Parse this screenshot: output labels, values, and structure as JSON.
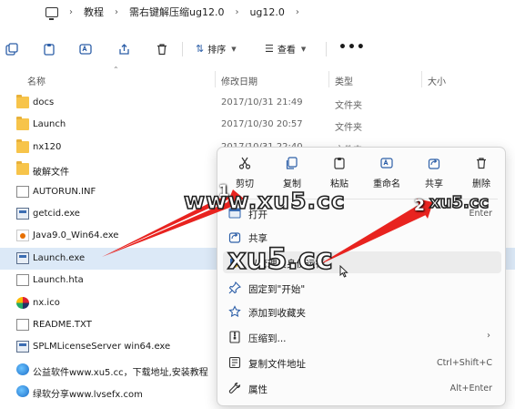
{
  "breadcrumb": [
    "教程",
    "需右键解压缩ug12.0",
    "ug12.0"
  ],
  "toolbar": {
    "sort_label": "排序",
    "view_label": "查看",
    "more_label": "•••"
  },
  "columns": {
    "name": "名称",
    "date": "修改日期",
    "type": "类型",
    "size": "大小"
  },
  "files": [
    {
      "name": "docs",
      "date": "2017/10/31 21:49",
      "type": "文件夹",
      "icon": "folder-icon"
    },
    {
      "name": "Launch",
      "date": "2017/10/30 20:57",
      "type": "文件夹",
      "icon": "folder-icon"
    },
    {
      "name": "nx120",
      "date": "2017/10/31 22:40",
      "type": "文件夹",
      "icon": "folder-icon"
    },
    {
      "name": "破解文件",
      "date": "",
      "type": "",
      "icon": "folder-icon"
    },
    {
      "name": "AUTORUN.INF",
      "date": "",
      "type": "",
      "icon": "document-icon"
    },
    {
      "name": "getcid.exe",
      "date": "",
      "type": "",
      "icon": "exe-icon"
    },
    {
      "name": "Java9.0_Win64.exe",
      "date": "",
      "type": "",
      "icon": "java-icon"
    },
    {
      "name": "Launch.exe",
      "date": "",
      "type": "",
      "icon": "exe-icon"
    },
    {
      "name": "Launch.hta",
      "date": "",
      "type": "",
      "icon": "document-icon"
    },
    {
      "name": "nx.ico",
      "date": "",
      "type": "",
      "icon": "ico-icon"
    },
    {
      "name": "README.TXT",
      "date": "",
      "type": "",
      "icon": "document-icon"
    },
    {
      "name": "SPLMLicenseServer win64.exe",
      "date": "",
      "type": "",
      "icon": "exe-icon"
    },
    {
      "name": "公益软件www.xu5.cc，下载地址,安装教程",
      "date": "",
      "type": "",
      "icon": "globe-icon"
    },
    {
      "name": "绿软分享www.lvsefx.com",
      "date": "",
      "type": "",
      "icon": "globe-icon"
    }
  ],
  "selected_file_index": 7,
  "context_menu": {
    "quick_actions": [
      {
        "label": "剪切",
        "icon": "scissors-icon"
      },
      {
        "label": "复制",
        "icon": "copy-icon"
      },
      {
        "label": "粘贴",
        "icon": "paste-icon"
      },
      {
        "label": "重命名",
        "icon": "rename-icon"
      },
      {
        "label": "共享",
        "icon": "share-icon"
      },
      {
        "label": "删除",
        "icon": "trash-icon"
      }
    ],
    "items": [
      {
        "label": "打开",
        "shortcut": "Enter",
        "icon": "open-icon"
      },
      {
        "label": "共享",
        "shortcut": "",
        "icon": "share-icon"
      },
      {
        "label": "以管理员身份运行",
        "shortcut": "",
        "icon": "shield-icon"
      },
      {
        "label": "固定到\"开始\"",
        "shortcut": "",
        "icon": "pin-icon"
      },
      {
        "label": "添加到收藏夹",
        "shortcut": "",
        "icon": "star-icon"
      },
      {
        "label": "压缩到...",
        "shortcut": "",
        "icon": "zip-icon"
      },
      {
        "label": "复制文件地址",
        "shortcut": "Ctrl+Shift+C",
        "icon": "copy-path-icon"
      },
      {
        "label": "属性",
        "shortcut": "Alt+Enter",
        "icon": "wrench-icon"
      }
    ],
    "submenu_arrow": "›"
  },
  "annotations": {
    "badge_1": "1",
    "badge_2": "2",
    "watermark_1": "www.xu5.cc",
    "watermark_2": "xu5.cc",
    "watermark_3": "xu5.cc"
  },
  "colors": {
    "selection": "#dce9f7",
    "folder": "#f7c44a",
    "arrow_red": "#e8231f"
  }
}
